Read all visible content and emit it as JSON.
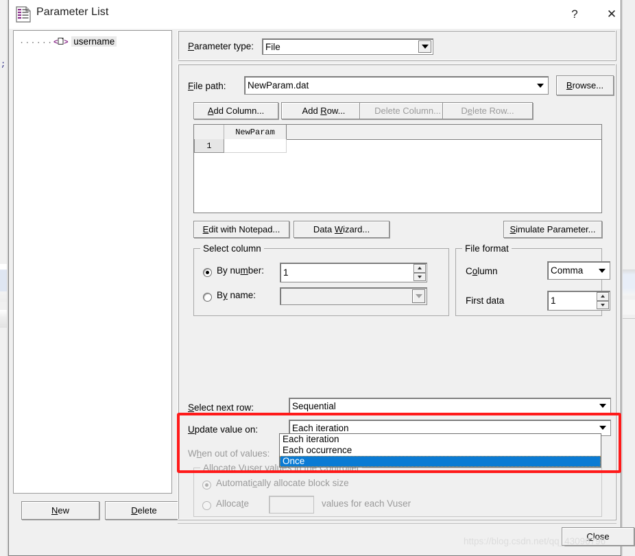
{
  "window": {
    "title": "Parameter List",
    "icon": "parameter-list-icon",
    "help_label": "?",
    "close_label": "✕"
  },
  "tree": {
    "items": [
      {
        "label": "username",
        "icon": "parameter-tag-icon",
        "selected": true
      }
    ]
  },
  "left_buttons": {
    "new": {
      "label": "New",
      "accel": "N"
    },
    "delete": {
      "label": "Delete",
      "accel": "D"
    }
  },
  "parameter_type": {
    "label": "Parameter type:",
    "accel": "P",
    "value": "File"
  },
  "file_path": {
    "label": "File path:",
    "accel": "F",
    "value": "NewParam.dat",
    "browse_label": "Browse...",
    "browse_accel": "B"
  },
  "row_column_buttons": [
    {
      "label": "Add Column...",
      "accel": "A",
      "disabled": false
    },
    {
      "label": "Add Row...",
      "accel": "R",
      "disabled": false
    },
    {
      "label": "Delete Column...",
      "accel": "",
      "disabled": true
    },
    {
      "label": "Delete Row...",
      "accel": "e",
      "disabled": true
    }
  ],
  "grid": {
    "columns": [
      "NewParam"
    ],
    "rows": [
      {
        "num": "1",
        "cells": [
          ""
        ]
      }
    ]
  },
  "tool_buttons": {
    "edit_notepad": {
      "label": "Edit with Notepad...",
      "accel": "E"
    },
    "data_wizard": {
      "label": "Data Wizard...",
      "accel": "W"
    },
    "simulate": {
      "label": "Simulate Parameter...",
      "accel": "S"
    }
  },
  "select_column": {
    "title": "Select column",
    "by_number": {
      "label": "By number:",
      "accel": "m",
      "checked": true,
      "value": "1"
    },
    "by_name": {
      "label": "By name:",
      "accel": "y",
      "checked": false,
      "value": ""
    }
  },
  "file_format": {
    "title": "File format",
    "column": {
      "label": "Column",
      "accel": "o",
      "value": "Comma"
    },
    "first_data": {
      "label": "First data",
      "value": "1"
    }
  },
  "select_next_row": {
    "label": "Select next row:",
    "accel": "S",
    "value": "Sequential"
  },
  "update_value_on": {
    "label": "Update value on:",
    "accel": "U",
    "value": "Each iteration",
    "options": [
      "Each iteration",
      "Each occurrence",
      "Once"
    ],
    "selected_option": "Once",
    "highlight_color": "#0a7bd4"
  },
  "when_out_of_values": {
    "label": "When out of values:",
    "accel": "h",
    "disabled": true
  },
  "allocate_group": {
    "title": "Allocate Vuser values in the Controller",
    "auto": {
      "label": "Automatically allocate block size",
      "accel": "c",
      "checked": true
    },
    "manual": {
      "label": "Allocate",
      "accel": "t",
      "checked": false,
      "value": "",
      "suffix": "values for each Vuser"
    }
  },
  "footer": {
    "close_label": "Close",
    "close_accel": "C"
  },
  "annotation": {
    "color": "#ff1a1a"
  },
  "watermark": "https://blog.csdn.net/qq_43096796"
}
